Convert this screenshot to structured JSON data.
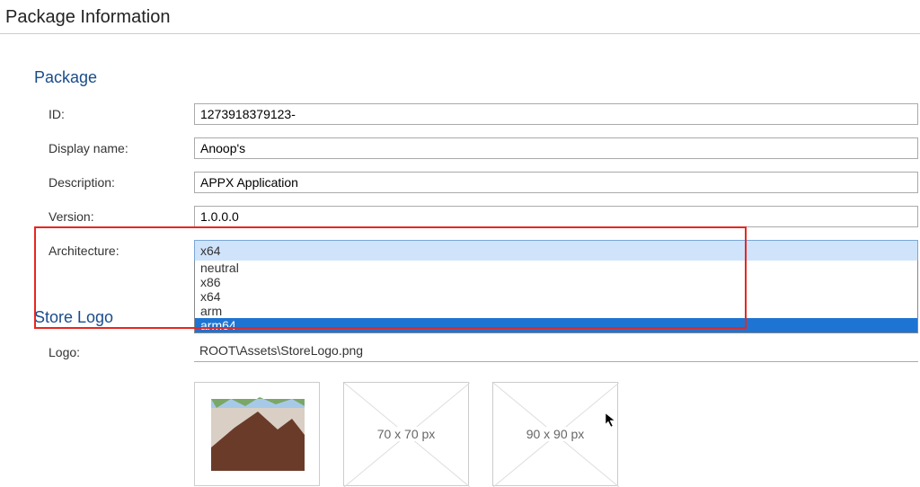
{
  "page_title": "Package Information",
  "sections": {
    "package": {
      "header": "Package",
      "fields": {
        "id": {
          "label": "ID:",
          "value": "1273918379123-"
        },
        "display_name": {
          "label": "Display name:",
          "value": "Anoop's"
        },
        "description": {
          "label": "Description:",
          "value": "APPX Application"
        },
        "version": {
          "label": "Version:",
          "value": "1.0.0.0"
        },
        "architecture": {
          "label": "Architecture:",
          "selected": "x64",
          "options": [
            "neutral",
            "x86",
            "x64",
            "arm",
            "arm64"
          ],
          "highlighted": "arm64"
        }
      }
    },
    "store_logo": {
      "header": "Store Logo",
      "logo": {
        "label": "Logo:",
        "value": "ROOT\\Assets\\StoreLogo.png"
      },
      "thumbs": [
        {
          "kind": "image"
        },
        {
          "kind": "placeholder",
          "text": "70 x 70 px"
        },
        {
          "kind": "placeholder",
          "text": "90 x 90 px"
        }
      ]
    }
  }
}
